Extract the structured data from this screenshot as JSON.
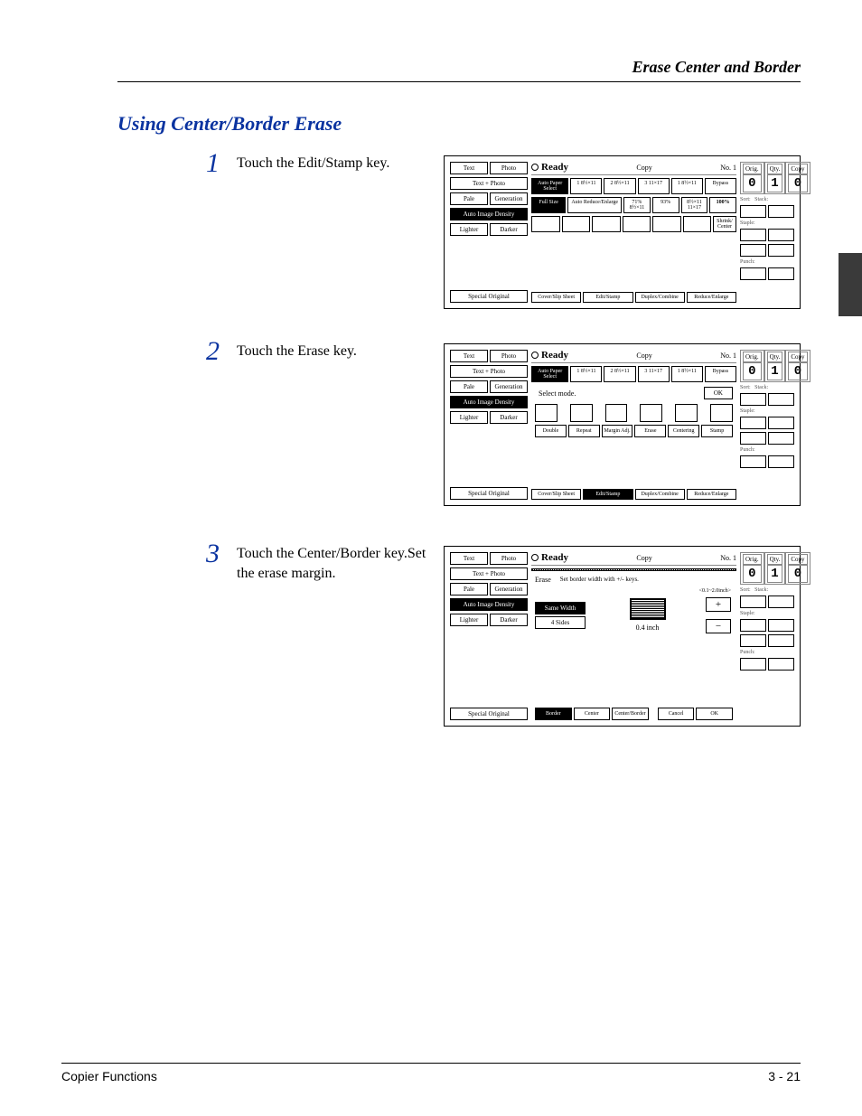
{
  "page_header": "Erase Center and Border",
  "section_title": "Using Center/Border Erase",
  "steps": [
    {
      "num": "1",
      "text": "Touch the Edit/Stamp key."
    },
    {
      "num": "2",
      "text": "Touch the Erase key."
    },
    {
      "num": "3",
      "text": "Touch the Center/Border key.Set the erase margin."
    }
  ],
  "footer_left": "Copier Functions",
  "footer_right": "3 - 21",
  "common_left": {
    "text_photo_pair": {
      "a": "Text",
      "b": "Photo"
    },
    "text_plus_photo": "Text + Photo",
    "pale_gen_pair": {
      "a": "Pale",
      "b": "Generation"
    },
    "auto_density": "Auto Image Density",
    "lighter_darker_pair": {
      "a": "Lighter",
      "b": "Darker"
    },
    "special_original": "Special Original"
  },
  "common_right": {
    "orig": "Orig.",
    "orig_val": "0",
    "qty": "Qty.",
    "qty_val": "1",
    "copy": "Copy",
    "copy_val": "0",
    "sort": "Sort:",
    "stack": "Stack:",
    "staple": "Staple:",
    "punch": "Punch:"
  },
  "status": {
    "ready": "Ready",
    "copy": "Copy",
    "no": "No. 1"
  },
  "panel1": {
    "auto_paper": "Auto Paper\nSelect",
    "papers": [
      "1  8½×11",
      "2  8½×11",
      "3  11×17",
      "1  8½×11",
      "Bypass"
    ],
    "full_size": "Full Size",
    "auto_re": "Auto Reduce/Enlarge",
    "preset1": "71%\n8½×11",
    "pct": "93%",
    "preset2": "8½×11\n11×17",
    "hundred": "100%",
    "shrink": "Shrink/\nCenter",
    "tabs": [
      "Cover/Slip Sheet",
      "Edit/Stamp",
      "Duplex/Combine",
      "Reduce/Enlarge"
    ]
  },
  "panel2": {
    "auto_paper": "Auto Paper\nSelect",
    "papers": [
      "1  8½×11",
      "2  8½×11",
      "3  11×17",
      "1  8½×11",
      "Bypass"
    ],
    "select_mode": "Select mode.",
    "ok": "OK",
    "modes": [
      "Double",
      "Repeat",
      "Margin Adj.",
      "Erase",
      "Centering",
      "Stamp"
    ],
    "tabs": [
      "Cover/Slip Sheet",
      "Edit/Stamp",
      "Duplex/Combine",
      "Reduce/Enlarge"
    ]
  },
  "panel3": {
    "erase": "Erase",
    "hint": "Set border width with +/- keys.",
    "range": "<0.1~2.0inch>",
    "same_width": "Same Width",
    "four_sides": "4 Sides",
    "value": "0.4 inch",
    "plus": "+",
    "minus": "−",
    "tabs": [
      "Border",
      "Center",
      "Center/Border",
      "Cancel",
      "OK"
    ]
  }
}
